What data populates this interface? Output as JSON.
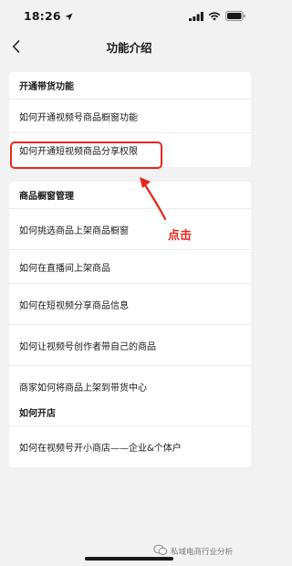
{
  "status_bar": {
    "time": "18:26"
  },
  "nav": {
    "title": "功能介绍"
  },
  "sections": [
    {
      "header": "开通带货功能",
      "items": [
        {
          "label": "如何开通视频号商品橱窗功能"
        },
        {
          "label": "如何开通短视频商品分享权限"
        }
      ]
    },
    {
      "header": "商品橱窗管理",
      "items": [
        {
          "label": "如何挑选商品上架商品橱窗"
        },
        {
          "label": "如何在直播间上架商品"
        },
        {
          "label": "如何在短视频分享商品信息"
        },
        {
          "label": "如何让视频号创作者带自己的商品"
        },
        {
          "label": "商家如何将商品上架到带货中心"
        }
      ]
    },
    {
      "header": "如何开店",
      "items": [
        {
          "label": "如何在视频号开小商店——企业&个体户"
        }
      ]
    }
  ],
  "annotation": {
    "text": "点击",
    "color": "#e8261c"
  },
  "watermark": {
    "text": "私域电商行业分析"
  }
}
